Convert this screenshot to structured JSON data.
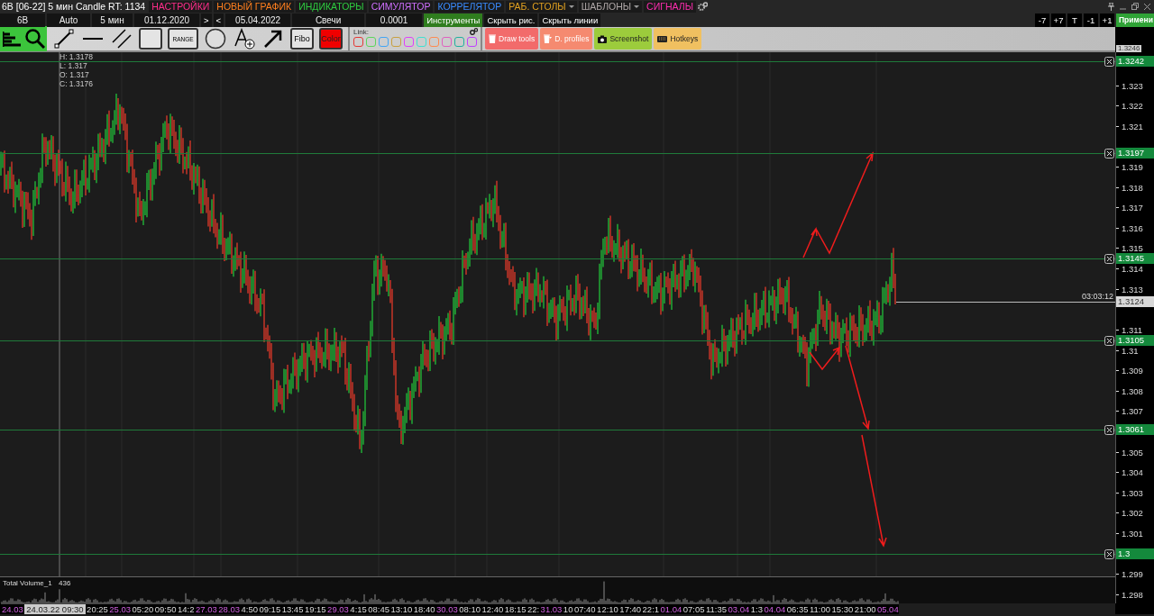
{
  "window": {
    "title": "6B [06-22] 5 мин Candle RT: 1134"
  },
  "menu": [
    {
      "label": "НАСТРОЙКИ",
      "color": "#ff2d8a",
      "dropdown": false
    },
    {
      "label": "НОВЫЙ ГРАФИК",
      "color": "#ff7f1e",
      "dropdown": false
    },
    {
      "label": "ИНДИКАТОРЫ",
      "color": "#2ecc40",
      "dropdown": false
    },
    {
      "label": "СИМУЛЯТОР",
      "color": "#d070ff",
      "dropdown": false
    },
    {
      "label": "КОРРЕЛЯТОР",
      "color": "#3a8cff",
      "dropdown": false
    },
    {
      "label": "РАБ. СТОЛЫ",
      "color": "#e0a020",
      "dropdown": true
    },
    {
      "label": "ШАБЛОНЫ",
      "color": "#b0a8a8",
      "dropdown": true
    },
    {
      "label": "СИГНАЛЫ",
      "color": "#ff2db0",
      "dropdown": false
    }
  ],
  "controls": {
    "symbol": "6B",
    "aggregation": "Auto",
    "timeframe": "5 мин",
    "date_from": "01.12.2020",
    "next": ">",
    "prev": "<",
    "date_to": "05.04.2022",
    "chart_type": "Свечи",
    "step": "0.0001"
  },
  "toggles": [
    {
      "label": "Инструменты",
      "selected": true
    },
    {
      "label": "Скрыть рис.",
      "selected": false
    },
    {
      "label": "Скрыть линии",
      "selected": false
    }
  ],
  "shift_buttons": [
    "-7",
    "+7",
    "T",
    "-1",
    "+1"
  ],
  "apply_button": "Примени",
  "tools": [
    {
      "kind": "segment"
    },
    {
      "kind": "hline"
    },
    {
      "kind": "channel"
    },
    {
      "kind": "rect"
    },
    {
      "kind": "range",
      "label": "RANGE"
    },
    {
      "kind": "circle"
    },
    {
      "kind": "text"
    },
    {
      "kind": "arrow"
    },
    {
      "kind": "fibo",
      "label": "Fibo"
    },
    {
      "kind": "color",
      "label": "Color"
    }
  ],
  "link": {
    "label": "Link:",
    "slots": [
      {
        "color": "#e53935"
      },
      {
        "color": "#5cd65c"
      },
      {
        "color": "#42a5f5"
      },
      {
        "color": "#c8a040"
      },
      {
        "color": "#e040fb"
      },
      {
        "color": "#40e0d0"
      },
      {
        "color": "#ff8a50"
      },
      {
        "color": "#e060c0"
      },
      {
        "color": "#20b0a0"
      },
      {
        "color": "#c040ff"
      }
    ]
  },
  "actions": [
    {
      "label": "Draw tools",
      "kind": "trash",
      "color": "#f26b6b"
    },
    {
      "label": "D. profiles",
      "kind": "trash-filter",
      "color": "#f58a70"
    },
    {
      "label": "Screenshot",
      "kind": "camera",
      "color": "#9ccc3c"
    },
    {
      "label": "Hotkeys",
      "kind": "keyboard",
      "color": "#f0c060"
    }
  ],
  "ohlc": [
    "H: 1.3178",
    "L: 1.317",
    "O: 1.317",
    "C: 1.3176"
  ],
  "price_axis": {
    "top_price": "1.3246",
    "ticks": [
      "1.323",
      "1.322",
      "1.321",
      "1.319",
      "1.318",
      "1.317",
      "1.316",
      "1.315",
      "1.314",
      "1.313",
      "1.311",
      "1.31",
      "1.309",
      "1.308",
      "1.307",
      "1.305",
      "1.304",
      "1.303",
      "1.302",
      "1.301",
      "1.299",
      "1.298"
    ]
  },
  "levels": [
    {
      "price": "1.3242"
    },
    {
      "price": "1.3197"
    },
    {
      "price": "1.3145"
    },
    {
      "price": "1.3105"
    },
    {
      "price": "1.3061"
    },
    {
      "price": "1.3"
    }
  ],
  "current_price": {
    "price": "1.3124",
    "timer": "03:03:12"
  },
  "volume": {
    "name": "Total Volume_1",
    "value": "436"
  },
  "time_axis": [
    {
      "label": "24.03",
      "kind": "date"
    },
    {
      "label": "24.03.22 09:30",
      "kind": "cursor"
    },
    {
      "label": "20:25",
      "kind": "time"
    },
    {
      "label": "25.03",
      "kind": "date"
    },
    {
      "label": "05:20",
      "kind": "time"
    },
    {
      "label": "09:50",
      "kind": "time"
    },
    {
      "label": "14:2",
      "kind": "time"
    },
    {
      "label": "27.03",
      "kind": "date"
    },
    {
      "label": "28.03",
      "kind": "date"
    },
    {
      "label": "4:50",
      "kind": "time"
    },
    {
      "label": "09:15",
      "kind": "time"
    },
    {
      "label": "13:45",
      "kind": "time"
    },
    {
      "label": "19:15",
      "kind": "time"
    },
    {
      "label": "29.03",
      "kind": "date"
    },
    {
      "label": "4:15",
      "kind": "time"
    },
    {
      "label": "08:45",
      "kind": "time"
    },
    {
      "label": "13:10",
      "kind": "time"
    },
    {
      "label": "18:40",
      "kind": "time"
    },
    {
      "label": "30.03",
      "kind": "date"
    },
    {
      "label": "08:10",
      "kind": "time"
    },
    {
      "label": "12:40",
      "kind": "time"
    },
    {
      "label": "18:15",
      "kind": "time"
    },
    {
      "label": "22:",
      "kind": "time"
    },
    {
      "label": "31.03",
      "kind": "date"
    },
    {
      "label": "10",
      "kind": "time"
    },
    {
      "label": "07:40",
      "kind": "time"
    },
    {
      "label": "12:10",
      "kind": "time"
    },
    {
      "label": "17:40",
      "kind": "time"
    },
    {
      "label": "22:1",
      "kind": "time"
    },
    {
      "label": "01.04",
      "kind": "date"
    },
    {
      "label": "07:05",
      "kind": "time"
    },
    {
      "label": "11:35",
      "kind": "time"
    },
    {
      "label": "03.04",
      "kind": "date"
    },
    {
      "label": "1:3",
      "kind": "time"
    },
    {
      "label": "04.04",
      "kind": "date"
    },
    {
      "label": "06:35",
      "kind": "time"
    },
    {
      "label": "11:00",
      "kind": "time"
    },
    {
      "label": "15:30",
      "kind": "time"
    },
    {
      "label": "21:00",
      "kind": "time"
    },
    {
      "label": "05.04",
      "kind": "date"
    }
  ]
}
